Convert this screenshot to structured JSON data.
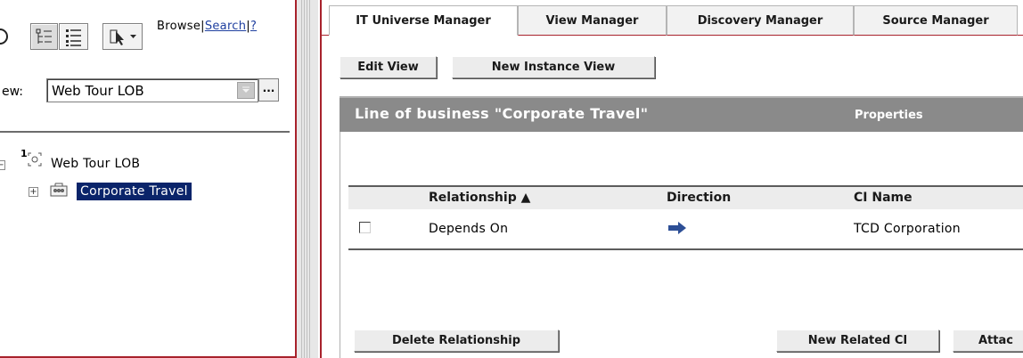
{
  "left_panel": {
    "toolbar": {
      "browse_label": "Browse",
      "separator": "|",
      "search_label": "Search",
      "help_label": "?"
    },
    "view_label": "ew:",
    "view_select": {
      "value": "Web Tour LOB",
      "more_label": "..."
    },
    "tree": {
      "root": {
        "badge": "1",
        "label": "Web Tour LOB",
        "expander": "−"
      },
      "child": {
        "label": "Corporate Travel",
        "expander": "+"
      }
    }
  },
  "tabs": [
    {
      "label": "IT Universe Manager",
      "active": true
    },
    {
      "label": "View Manager"
    },
    {
      "label": "Discovery Manager"
    },
    {
      "label": "Source Manager"
    }
  ],
  "buttons": {
    "edit_view": "Edit View",
    "new_instance_view": "New Instance View",
    "delete_relationship": "Delete Relationship",
    "new_related_ci": "New Related CI",
    "attach": "Attac"
  },
  "section": {
    "title": "Line of business \"Corporate Travel\"",
    "properties_label": "Properties"
  },
  "table": {
    "columns": [
      "Relationship ▲",
      "Direction",
      "CI Name"
    ],
    "rows": [
      {
        "relationship": "Depends On",
        "direction_icon": "right-arrow-icon",
        "ci_name": "TCD Corporation"
      }
    ]
  },
  "colors": {
    "pane_border": "#a8222c",
    "section_header": "#8a8a8a",
    "selection": "#0a246a"
  }
}
